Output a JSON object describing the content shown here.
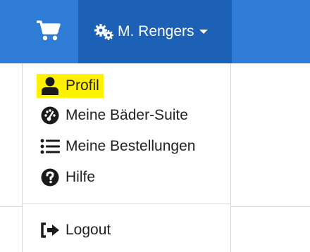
{
  "navbar": {
    "cart_icon": "shopping-cart-icon",
    "user_icon": "gears-icon",
    "user_name": "M. Rengers",
    "caret_icon": "caret-down-icon",
    "colors": {
      "bar": "#2e7cd6",
      "user_active": "#1d61b6",
      "text": "#ffffff"
    }
  },
  "menu": {
    "items": [
      {
        "label": "Profil",
        "icon": "user-icon",
        "highlighted": true
      },
      {
        "label": "Meine Bäder-Suite",
        "icon": "dashboard-icon"
      },
      {
        "label": "Meine Bestellungen",
        "icon": "list-icon"
      },
      {
        "label": "Hilfe",
        "icon": "question-circle-icon"
      }
    ],
    "logout": {
      "label": "Logout",
      "icon": "sign-out-icon"
    },
    "highlight_color": "#fff200"
  }
}
